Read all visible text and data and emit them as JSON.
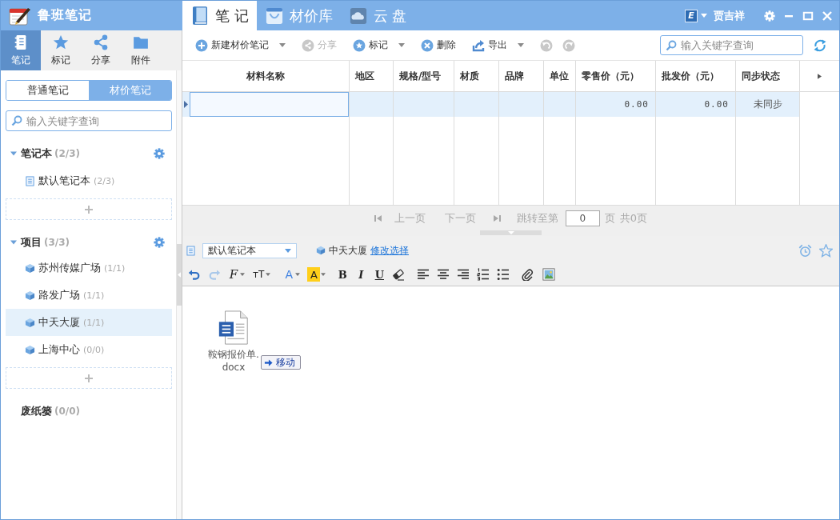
{
  "app": {
    "title": "鲁班笔记"
  },
  "top_tabs": [
    {
      "label": "笔 记",
      "kind": "book",
      "selected": true
    },
    {
      "label": "材价库",
      "kind": "bag",
      "selected": false
    },
    {
      "label": "云 盘",
      "kind": "cloud",
      "selected": false
    }
  ],
  "account": {
    "badge": "E",
    "name": "贾吉祥"
  },
  "side_tabs": [
    {
      "label": "笔记",
      "kind": "notebook",
      "selected": true
    },
    {
      "label": "标记",
      "kind": "star",
      "selected": false
    },
    {
      "label": "分享",
      "kind": "share",
      "selected": false
    },
    {
      "label": "附件",
      "kind": "folder",
      "selected": false
    }
  ],
  "note_types": [
    {
      "label": "普通笔记",
      "selected": false
    },
    {
      "label": "材价笔记",
      "selected": true
    }
  ],
  "sidebar_search": {
    "placeholder": "输入关键字查询"
  },
  "tree": [
    {
      "kind": "group",
      "label": "笔记本",
      "count": "(2/3)",
      "expanded": true,
      "children": [
        {
          "kind": "notebook",
          "label": "默认笔记本",
          "count": "(2/3)",
          "selected": false
        }
      ]
    },
    {
      "kind": "group",
      "label": "项目",
      "count": "(3/3)",
      "expanded": true,
      "children": [
        {
          "kind": "project",
          "label": "苏州传媒广场",
          "count": "(1/1)",
          "selected": false
        },
        {
          "kind": "project",
          "label": "路发广场",
          "count": "(1/1)",
          "selected": false
        },
        {
          "kind": "project",
          "label": "中天大厦",
          "count": "(1/1)",
          "selected": true
        },
        {
          "kind": "project",
          "label": "上海中心",
          "count": "(0/0)",
          "selected": false
        }
      ]
    },
    {
      "kind": "trash",
      "label": "废纸篓",
      "count": "(0/0)"
    }
  ],
  "toolbar": [
    {
      "kind": "add",
      "label": "新建材价笔记",
      "dropdown": true,
      "disabled": false
    },
    {
      "kind": "share",
      "label": "分享",
      "dropdown": false,
      "disabled": true
    },
    {
      "kind": "star",
      "label": "标记",
      "dropdown": true,
      "disabled": false
    },
    {
      "kind": "delete",
      "label": "删除",
      "dropdown": false,
      "disabled": false
    },
    {
      "kind": "export",
      "label": "导出",
      "dropdown": true,
      "disabled": false
    },
    {
      "kind": "undo",
      "dropdown": false,
      "disabled": true
    },
    {
      "kind": "redo",
      "dropdown": false,
      "disabled": true
    }
  ],
  "search": {
    "placeholder": "输入关键字查询"
  },
  "table": {
    "columns": [
      "材料名称",
      "地区",
      "规格/型号",
      "材质",
      "品牌",
      "单位",
      "零售价（元）",
      "批发价（元）",
      "同步状态"
    ],
    "rows": [
      {
        "selected": true,
        "editing": true,
        "cells": [
          null,
          null,
          null,
          null,
          null,
          null,
          "0.00",
          "0.00",
          "未同步"
        ]
      }
    ]
  },
  "pager": {
    "disabled": true,
    "prev": "上一页",
    "next": "下一页",
    "jump_label": "跳转至第",
    "page": "0",
    "page_unit": "页",
    "total": "共0页"
  },
  "editor": {
    "notebook": "默认笔记本",
    "project": "中天大厦",
    "change_link": "修改选择",
    "format_tools": [
      {
        "kind": "undo",
        "dropdown": false,
        "disabled": false
      },
      {
        "kind": "redo",
        "dropdown": false,
        "disabled": true
      },
      {
        "kind": "font",
        "glyph": "F",
        "dropdown": true,
        "disabled": false
      },
      {
        "kind": "font_size",
        "glyph": "тT",
        "dropdown": true,
        "disabled": false
      },
      {
        "kind": "font_color",
        "glyph": "A",
        "dropdown": true,
        "disabled": false
      },
      {
        "kind": "highlight",
        "glyph": "A",
        "dropdown": true,
        "disabled": false
      },
      {
        "kind": "bold",
        "glyph": "B",
        "dropdown": false,
        "disabled": false
      },
      {
        "kind": "italic",
        "glyph": "I",
        "dropdown": false,
        "disabled": false
      },
      {
        "kind": "underline",
        "glyph": "U",
        "dropdown": false,
        "disabled": false
      },
      {
        "kind": "eraser",
        "dropdown": false,
        "disabled": false
      },
      {
        "kind": "align_left",
        "dropdown": false,
        "disabled": false
      },
      {
        "kind": "align_center",
        "dropdown": false,
        "disabled": false
      },
      {
        "kind": "align_right",
        "dropdown": false,
        "disabled": false
      },
      {
        "kind": "numbered_list",
        "dropdown": false,
        "disabled": false
      },
      {
        "kind": "bullet_list",
        "dropdown": false,
        "disabled": false
      },
      {
        "kind": "attachment",
        "dropdown": false,
        "disabled": false
      },
      {
        "kind": "image",
        "dropdown": false,
        "disabled": false
      }
    ],
    "attachments": [
      {
        "kind": "word",
        "name": "鞍钢报价单.docx"
      }
    ],
    "drag_hint": "移动"
  }
}
